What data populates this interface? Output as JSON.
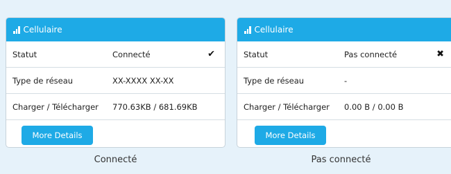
{
  "colors": {
    "background": "#e6f2fa",
    "accent": "#1eaae6"
  },
  "cards": [
    {
      "title": "Cellulaire",
      "title_icon": "signal-bars-icon",
      "rows": [
        {
          "label": "Statut",
          "value": "Connecté",
          "icon": "checkmark-icon",
          "icon_glyph": "✔"
        },
        {
          "label": "Type de réseau",
          "value": "XX-XXXX XX-XX"
        },
        {
          "label": "Charger / Télécharger",
          "value": "770.63KB / 681.69KB"
        }
      ],
      "button_label": "More Details",
      "caption": "Connecté"
    },
    {
      "title": "Cellulaire",
      "title_icon": "signal-bars-icon",
      "rows": [
        {
          "label": "Statut",
          "value": "Pas connecté",
          "icon": "cross-icon",
          "icon_glyph": "✖"
        },
        {
          "label": "Type de réseau",
          "value": "-"
        },
        {
          "label": "Charger / Télécharger",
          "value": "0.00 B / 0.00 B"
        }
      ],
      "button_label": "More Details",
      "caption": "Pas connecté"
    }
  ]
}
